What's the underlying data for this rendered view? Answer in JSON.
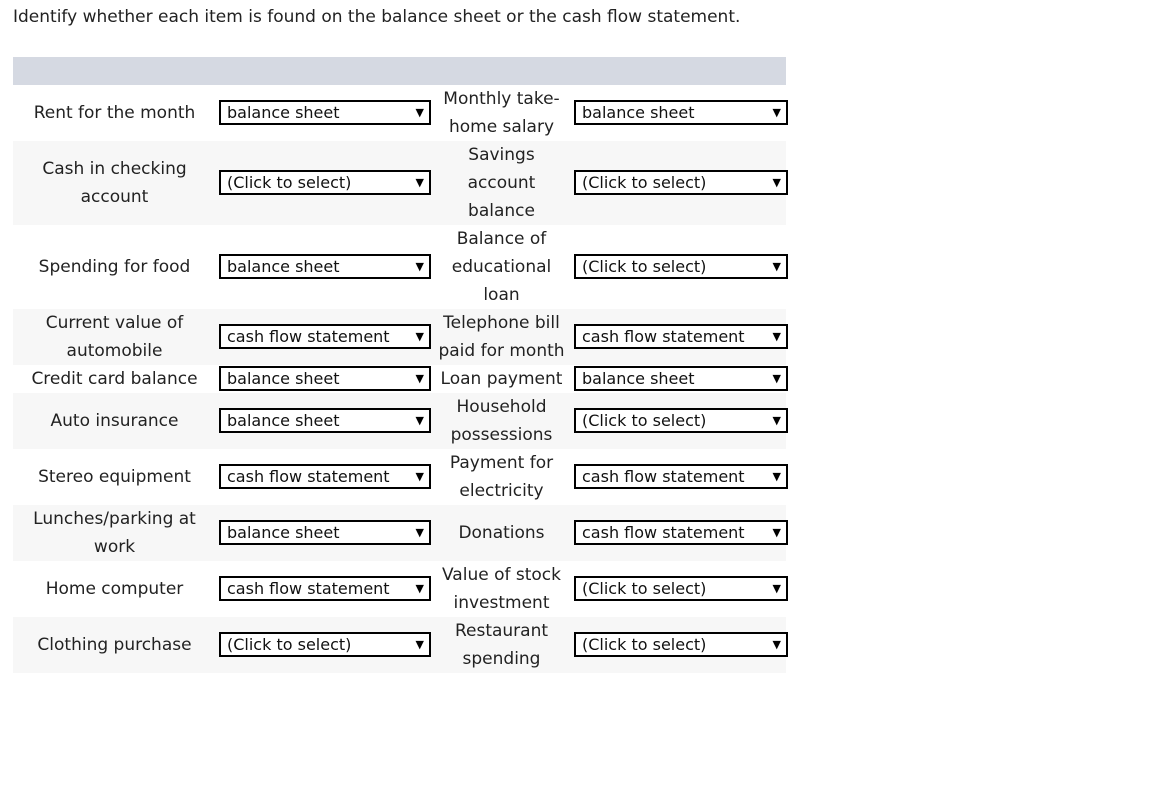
{
  "instruction": "Identify whether each item is found on the balance sheet or the cash flow statement.",
  "colors": {
    "header_bar": "#d5d9e2",
    "stripe_row": "#f7f7f7",
    "page_background": "#ffffff",
    "select_border": "#000000",
    "text": "#222222"
  },
  "header": {
    "col1": "",
    "col2": "",
    "col3": "",
    "col4": ""
  },
  "select_options": [
    "(Click to select)",
    "balance sheet",
    "cash flow statement"
  ],
  "caret_glyph": "▼",
  "rows": [
    {
      "left_label": "Rent for the month",
      "left_value": "balance sheet",
      "right_label": "Monthly take-home salary",
      "right_value": "balance sheet"
    },
    {
      "left_label": "Cash in checking account",
      "left_value": "(Click to select)",
      "right_label": "Savings account balance",
      "right_value": "(Click to select)"
    },
    {
      "left_label": "Spending for food",
      "left_value": "balance sheet",
      "right_label": "Balance of educational loan",
      "right_value": "(Click to select)"
    },
    {
      "left_label": "Current value of automobile",
      "left_value": "cash flow statement",
      "right_label": "Telephone bill paid for month",
      "right_value": "cash flow statement"
    },
    {
      "left_label": "Credit card balance",
      "left_value": "balance sheet",
      "right_label": "Loan payment",
      "right_value": "balance sheet"
    },
    {
      "left_label": "Auto insurance",
      "left_value": "balance sheet",
      "right_label": "Household possessions",
      "right_value": "(Click to select)"
    },
    {
      "left_label": "Stereo equipment",
      "left_value": "cash flow statement",
      "right_label": "Payment for electricity",
      "right_value": "cash flow statement"
    },
    {
      "left_label": "Lunches/parking at work",
      "left_value": "balance sheet",
      "right_label": "Donations",
      "right_value": "cash flow statement"
    },
    {
      "left_label": "Home computer",
      "left_value": "cash flow statement",
      "right_label": "Value of stock investment",
      "right_value": "(Click to select)"
    },
    {
      "left_label": "Clothing purchase",
      "left_value": "(Click to select)",
      "right_label": "Restaurant spending",
      "right_value": "(Click to select)"
    }
  ]
}
